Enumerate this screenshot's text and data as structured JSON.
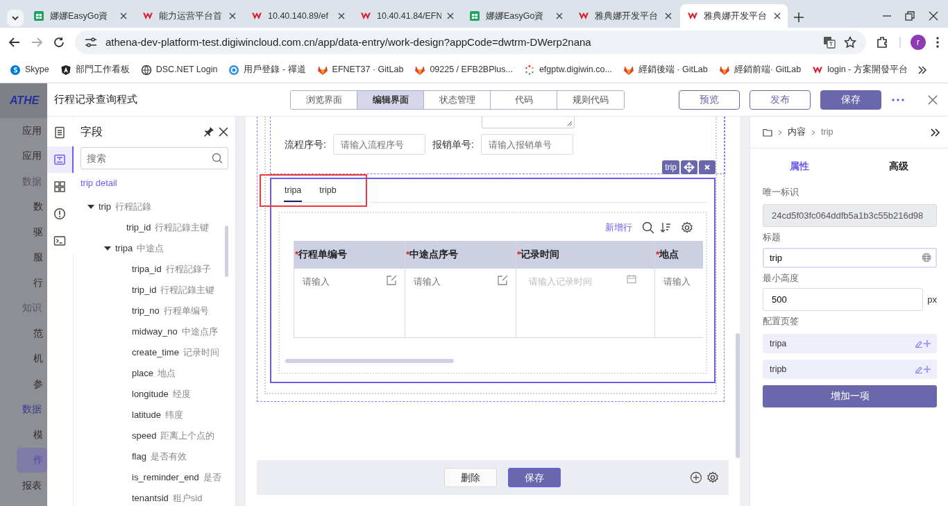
{
  "browser": {
    "tabs": [
      {
        "title": "娜娜EasyGo資",
        "kind": "sheet",
        "selected": false
      },
      {
        "title": "能力运营平台首",
        "kind": "logo",
        "selected": false
      },
      {
        "title": "10.40.140.89/ef",
        "kind": "logo",
        "selected": false
      },
      {
        "title": "10.40.41.84/EFN",
        "kind": "logo",
        "selected": false
      },
      {
        "title": "娜娜EasyGo資",
        "kind": "sheet",
        "selected": false
      },
      {
        "title": "雅典娜开发平台",
        "kind": "logo",
        "selected": false
      },
      {
        "title": "雅典娜开发平台",
        "kind": "logo",
        "selected": true
      }
    ],
    "address": "athena-dev-platform-test.digiwincloud.com.cn/app/data-entry/work-design?appCode=dwtrm-DWerp2nana",
    "profile": "r",
    "bookmarks": [
      {
        "label": "Skype",
        "kind": "skype"
      },
      {
        "label": "部門工作看板",
        "kind": "angular"
      },
      {
        "label": "DSC.NET Login",
        "kind": "globe"
      },
      {
        "label": "用戶登錄 - 禪道",
        "kind": "zentao"
      },
      {
        "label": "EFNET37 · GitLab",
        "kind": "gitlab"
      },
      {
        "label": "09225 / EFB2BPlus...",
        "kind": "gitlab"
      },
      {
        "label": "efgptw.digiwin.co...",
        "kind": "spinner"
      },
      {
        "label": "經銷後端 · GitLab",
        "kind": "gitlab"
      },
      {
        "label": "經銷前端· GitLab",
        "kind": "gitlab"
      },
      {
        "label": "login - 方案開發平台",
        "kind": "logo"
      }
    ]
  },
  "background_nav": {
    "logo": "ATHE",
    "items": [
      {
        "label": "应用",
        "kind": "group",
        "selected": false
      },
      {
        "label": "应用",
        "kind": "group",
        "selected": false
      },
      {
        "label": "数据",
        "kind": "section",
        "selected": false
      },
      {
        "label": "数",
        "kind": "item",
        "selected": false
      },
      {
        "label": "驱",
        "kind": "item",
        "selected": false
      },
      {
        "label": "服",
        "kind": "item",
        "selected": false
      },
      {
        "label": "行",
        "kind": "item",
        "selected": false
      },
      {
        "label": "知识",
        "kind": "section",
        "selected": false
      },
      {
        "label": "范",
        "kind": "item",
        "selected": false
      },
      {
        "label": "机",
        "kind": "item",
        "selected": false
      },
      {
        "label": "参",
        "kind": "item",
        "selected": false
      },
      {
        "label": "数据",
        "kind": "section-active",
        "selected": false
      },
      {
        "label": "模",
        "kind": "item",
        "selected": false
      },
      {
        "label": "作",
        "kind": "item",
        "selected": true
      },
      {
        "label": "报表",
        "kind": "group",
        "selected": false
      }
    ]
  },
  "drawer": {
    "title": "行程记录查询程式",
    "view_tabs": [
      {
        "label": "浏览界面",
        "selected": false
      },
      {
        "label": "编辑界面",
        "selected": true
      },
      {
        "label": "状态管理",
        "selected": false
      },
      {
        "label": "代码",
        "selected": false
      },
      {
        "label": "规则代码",
        "selected": false
      }
    ],
    "actions": [
      {
        "label": "预览",
        "kind": "outline"
      },
      {
        "label": "发布",
        "kind": "outline"
      },
      {
        "label": "保存",
        "kind": "primary"
      }
    ]
  },
  "rail": [
    {
      "kind": "doc",
      "selected": false
    },
    {
      "kind": "form",
      "selected": true
    },
    {
      "kind": "grid",
      "selected": false
    },
    {
      "kind": "alert",
      "selected": false
    },
    {
      "kind": "terminal",
      "selected": false
    }
  ],
  "fields_panel": {
    "title": "字段",
    "search": {
      "placeholder": "搜索"
    },
    "root": "trip detail",
    "tree": [
      {
        "name": "trip",
        "label": "行程記錄",
        "expanded": true,
        "children": [
          {
            "name": "trip_id",
            "label": "行程記錄主键"
          },
          {
            "name": "tripa",
            "label": "中途点",
            "expanded": true,
            "children": [
              {
                "name": "tripa_id",
                "label": "行程記錄子"
              },
              {
                "name": "trip_id",
                "label": "行程記錄主键"
              },
              {
                "name": "trip_no",
                "label": "行程单编号"
              },
              {
                "name": "midway_no",
                "label": "中途点序"
              },
              {
                "name": "create_time",
                "label": "记录时间"
              },
              {
                "name": "place",
                "label": "地点"
              },
              {
                "name": "longitude",
                "label": "经度"
              },
              {
                "name": "latitude",
                "label": "纬度"
              },
              {
                "name": "speed",
                "label": "距离上个点的"
              },
              {
                "name": "flag",
                "label": "是否有效"
              },
              {
                "name": "is_reminder_end",
                "label": "是否"
              },
              {
                "name": "tenantsid",
                "label": "租户sid"
              }
            ]
          }
        ]
      }
    ]
  },
  "canvas": {
    "form_fields": [
      {
        "label": "流程序号:",
        "placeholder": "请输入流程序号"
      },
      {
        "label": "报销单号:",
        "placeholder": "请输入报销单号"
      }
    ],
    "component": {
      "chip": "trip",
      "tabs": [
        {
          "label": "tripa",
          "selected": true
        },
        {
          "label": "tripb",
          "selected": false
        }
      ],
      "toolbar": {
        "add_row": "新增行"
      },
      "columns": [
        {
          "mark": "*",
          "label": "行程单编号"
        },
        {
          "mark": "*",
          "label": "中途点序号"
        },
        {
          "mark": "*",
          "label": "记录时间"
        },
        {
          "mark": "*",
          "label": "地点"
        }
      ],
      "cells": [
        {
          "placeholder": "请输入",
          "kind": "edit"
        },
        {
          "placeholder": "请输入",
          "kind": "edit"
        },
        {
          "placeholder": "请输入记录时间",
          "kind": "date"
        },
        {
          "placeholder": "请输入",
          "kind": "plain"
        }
      ]
    },
    "footer": [
      {
        "label": "删除",
        "kind": "outline"
      },
      {
        "label": "保存",
        "kind": "primary"
      }
    ]
  },
  "properties": {
    "breadcrumb": [
      "内容",
      "trip"
    ],
    "tabs": [
      {
        "label": "属性",
        "selected": true
      },
      {
        "label": "高级",
        "selected": false
      }
    ],
    "unique_id": {
      "label": "唯一标识",
      "value": "24cd5f03fc064ddfb5a1b3c55b216d98"
    },
    "title_field": {
      "label": "标题",
      "value": "trip"
    },
    "min_height": {
      "label": "最小高度",
      "value": "500",
      "unit": "px"
    },
    "tab_config": {
      "label": "配置页签",
      "items": [
        "tripa",
        "tripb"
      ],
      "add_button": "增加一项"
    }
  }
}
